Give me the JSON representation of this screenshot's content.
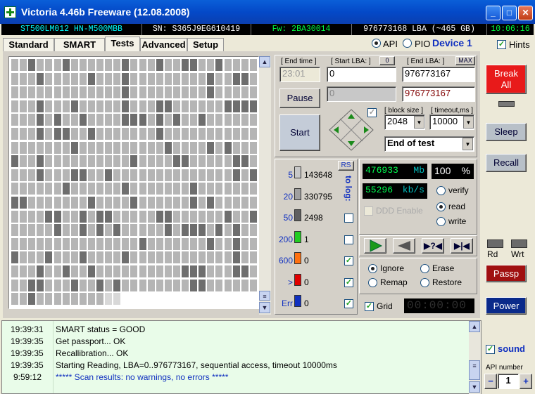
{
  "window": {
    "title": "Victoria 4.46b Freeware (12.08.2008)"
  },
  "infobar": {
    "model": "ST500LM012 HN-M500MBB",
    "serial": "SN: S365J9EG610419",
    "firmware": "Fw: 2BA30014",
    "lba": "976773168 LBA (~465 GB)",
    "clock": "10:06:16"
  },
  "tabs": [
    "Standard",
    "SMART",
    "Tests",
    "Advanced",
    "Setup"
  ],
  "active_tab": "Tests",
  "mode": {
    "api_label": "API",
    "pio_label": "PIO",
    "device_label": "Device 1",
    "hints_label": "Hints"
  },
  "tests": {
    "end_time_label": "[ End time ]",
    "end_time_value": "23:01",
    "start_lba_label": "[ Start LBA: ]",
    "start_lba_btn": "0",
    "start_lba_value": "0",
    "start_lba_current": "0",
    "end_lba_label": "[ End LBA: ]",
    "end_lba_btn": "MAX",
    "end_lba_value": "976773167",
    "end_lba_current": "976773167",
    "pause_label": "Pause",
    "start_label": "Start",
    "block_size_label": "[ block size ]",
    "block_size_value": "2048",
    "timeout_label": "[ timeout,ms ]",
    "timeout_value": "10000",
    "end_action_value": "End of test"
  },
  "stats": {
    "rs_label": "RS",
    "to_log_label": "to log:",
    "rows": [
      {
        "label": "5",
        "count": "143648",
        "color": "#c8c8c8",
        "logged": false
      },
      {
        "label": "20",
        "count": "330795",
        "color": "#a0a0a0",
        "logged": false
      },
      {
        "label": "50",
        "count": "2498",
        "color": "#606060",
        "logged": false
      },
      {
        "label": "200",
        "count": "1",
        "color": "#22cc22",
        "logged": false
      },
      {
        "label": "600",
        "count": "0",
        "color": "#ff7010",
        "logged": true
      },
      {
        "label": ">",
        "count": "0",
        "color": "#e00000",
        "logged": true
      },
      {
        "label": "Err",
        "count": "0",
        "color": "#1030c0",
        "logged": true
      }
    ]
  },
  "progress": {
    "mb_value": "476933",
    "mb_unit": "Mb",
    "percent_value": "100",
    "percent_unit": "%",
    "speed_value": "55296",
    "speed_unit": "kb/s",
    "ddd_label": "DDD Enable",
    "verify_label": "verify",
    "read_label": "read",
    "write_label": "write",
    "ignore_label": "Ignore",
    "erase_label": "Erase",
    "remap_label": "Remap",
    "restore_label": "Restore",
    "grid_label": "Grid",
    "timer_value": "00:00:00"
  },
  "side": {
    "break_label": "Break All",
    "sleep_label": "Sleep",
    "recall_label": "Recall",
    "rd_label": "Rd",
    "wrt_label": "Wrt",
    "passp_label": "Passp",
    "power_label": "Power",
    "sound_label": "sound",
    "api_number_label": "API number",
    "api_number_value": "1",
    "minus_label": "−",
    "plus_label": "+"
  },
  "log": [
    {
      "time": "19:39:31",
      "msg": "SMART status = GOOD"
    },
    {
      "time": "19:39:35",
      "msg": "Get passport... OK"
    },
    {
      "time": "19:39:35",
      "msg": "Recallibration... OK"
    },
    {
      "time": "19:39:35",
      "msg": "Starting Reading, LBA=0..976773167, sequential access, timeout 10000ms"
    },
    {
      "time": "9:59:12",
      "msg": "***** Scan results: no warnings, no errors *****"
    }
  ],
  "colors": {
    "title_bar": "#0449c8",
    "info_green": "#00ff40",
    "info_cyan": "#00ffff",
    "lcd_green": "#00ff50",
    "break_red": "#e81a1a",
    "passp_red": "#a01010",
    "power_blue": "#0a2a8a",
    "log_bg": "#e9fce9"
  }
}
